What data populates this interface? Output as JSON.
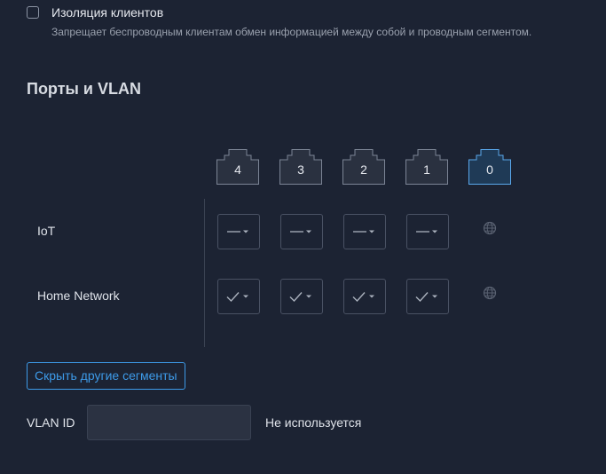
{
  "isolation": {
    "label": "Изоляция клиентов",
    "description": "Запрещает беспроводным клиентам обмен информацией между собой и проводным сегментом.",
    "checked": false
  },
  "ports_section": {
    "title": "Порты и VLAN",
    "ports": [
      {
        "label": "4",
        "selected": false
      },
      {
        "label": "3",
        "selected": false
      },
      {
        "label": "2",
        "selected": false
      },
      {
        "label": "1",
        "selected": false
      },
      {
        "label": "0",
        "selected": true
      }
    ],
    "rows": [
      {
        "name": "IoT",
        "port_modes": [
          "dash-icon",
          "dash-icon",
          "dash-icon",
          "dash-icon"
        ],
        "wan_icon": "globe-icon"
      },
      {
        "name": "Home Network",
        "port_modes": [
          "check-icon",
          "check-icon",
          "check-icon",
          "check-icon"
        ],
        "wan_icon": "globe-icon"
      }
    ]
  },
  "hide_segments_button": "Скрыть другие сегменты",
  "vlan": {
    "label": "VLAN ID",
    "value": "",
    "status": "Не используется"
  },
  "colors": {
    "background": "#1c2333",
    "accent": "#3d9ae8",
    "selected_port": "#1f3a56"
  }
}
